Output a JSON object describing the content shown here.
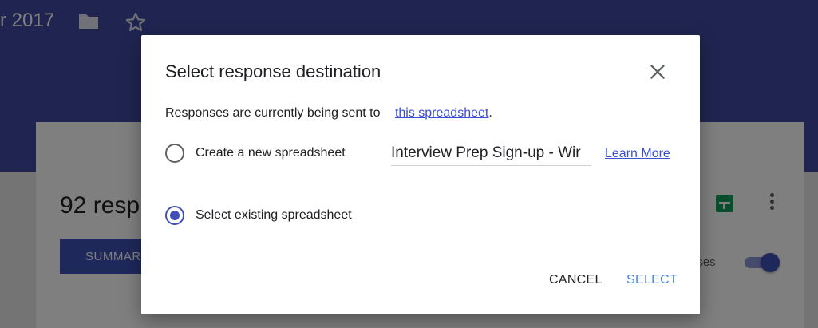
{
  "app": {
    "form_title": "r 2017",
    "folder_icon": "folder-icon",
    "star_icon": "star-icon",
    "responses_count": "92 resp",
    "summary_label": "SUMMARY",
    "accepting_label": "nses",
    "accepting_toggle_on": true,
    "header_color": "#3f4aa0"
  },
  "dialog": {
    "title": "Select response destination",
    "close_icon": "close-icon",
    "description": "Responses are currently being sent to",
    "description_link": "this spreadsheet",
    "description_suffix": ".",
    "options": [
      {
        "label": "Create a new spreadsheet",
        "checked": false
      },
      {
        "label": "Select existing spreadsheet",
        "checked": true
      }
    ],
    "new_sheet_name": "Interview Prep Sign-up - Wir",
    "learn_more": "Learn More",
    "cancel_label": "CANCEL",
    "select_label": "SELECT"
  },
  "colors": {
    "accent": "#3f51b5",
    "link": "#3b4fd1",
    "select_button": "#4285f4"
  }
}
